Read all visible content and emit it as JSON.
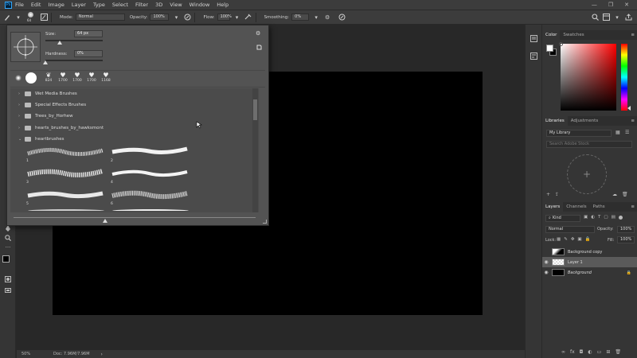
{
  "menubar": {
    "logo": "Ps",
    "items": [
      "File",
      "Edit",
      "Image",
      "Layer",
      "Type",
      "Select",
      "Filter",
      "3D",
      "View",
      "Window",
      "Help"
    ],
    "window_controls": [
      "—",
      "❐",
      "✕"
    ]
  },
  "options": {
    "brush_size": "64",
    "mode_label": "Mode:",
    "mode_value": "Normal",
    "opacity_label": "Opacity:",
    "opacity_value": "100%",
    "flow_label": "Flow:",
    "flow_value": "100%",
    "smoothing_label": "Smoothing:",
    "smoothing_value": "0%"
  },
  "brush_panel": {
    "size_label": "Size:",
    "size_value": "64 px",
    "size_fraction": 0.25,
    "hardness_label": "Hardness:",
    "hardness_value": "0%",
    "presets": [
      "",
      "",
      "824",
      "1700",
      "1700",
      "1700",
      "1168"
    ],
    "folders": [
      {
        "label": "Wet Media Brushes",
        "expanded": false
      },
      {
        "label": "Special Effects Brushes",
        "expanded": false
      },
      {
        "label": "Trees_by_Horhew",
        "expanded": false
      },
      {
        "label": "hearts_brushes_by_hawksmont",
        "expanded": false
      },
      {
        "label": "heartbrushes",
        "expanded": true
      }
    ],
    "strokes": [
      "1",
      "2",
      "3",
      "4",
      "5",
      "6"
    ]
  },
  "status": {
    "zoom": "50%",
    "doc": "Doc: 7.96M/7.96M"
  },
  "color_panel": {
    "tabs": [
      "Color",
      "Swatches"
    ],
    "hue_color": "#ff0000"
  },
  "libraries_panel": {
    "tabs": [
      "Libraries",
      "Adjustments"
    ],
    "library_name": "My Library",
    "search_placeholder": "Search Adobe Stock"
  },
  "layers_panel": {
    "tabs": [
      "Layers",
      "Channels",
      "Paths"
    ],
    "kind_label": "Kind",
    "blend_mode": "Normal",
    "opacity_label": "Opacity:",
    "opacity_value": "100%",
    "lock_label": "Lock:",
    "fill_label": "Fill:",
    "fill_value": "100%",
    "layers": [
      {
        "name": "Background copy",
        "visible": false
      },
      {
        "name": "Layer 1",
        "visible": true
      },
      {
        "name": "Background",
        "visible": true
      }
    ]
  }
}
